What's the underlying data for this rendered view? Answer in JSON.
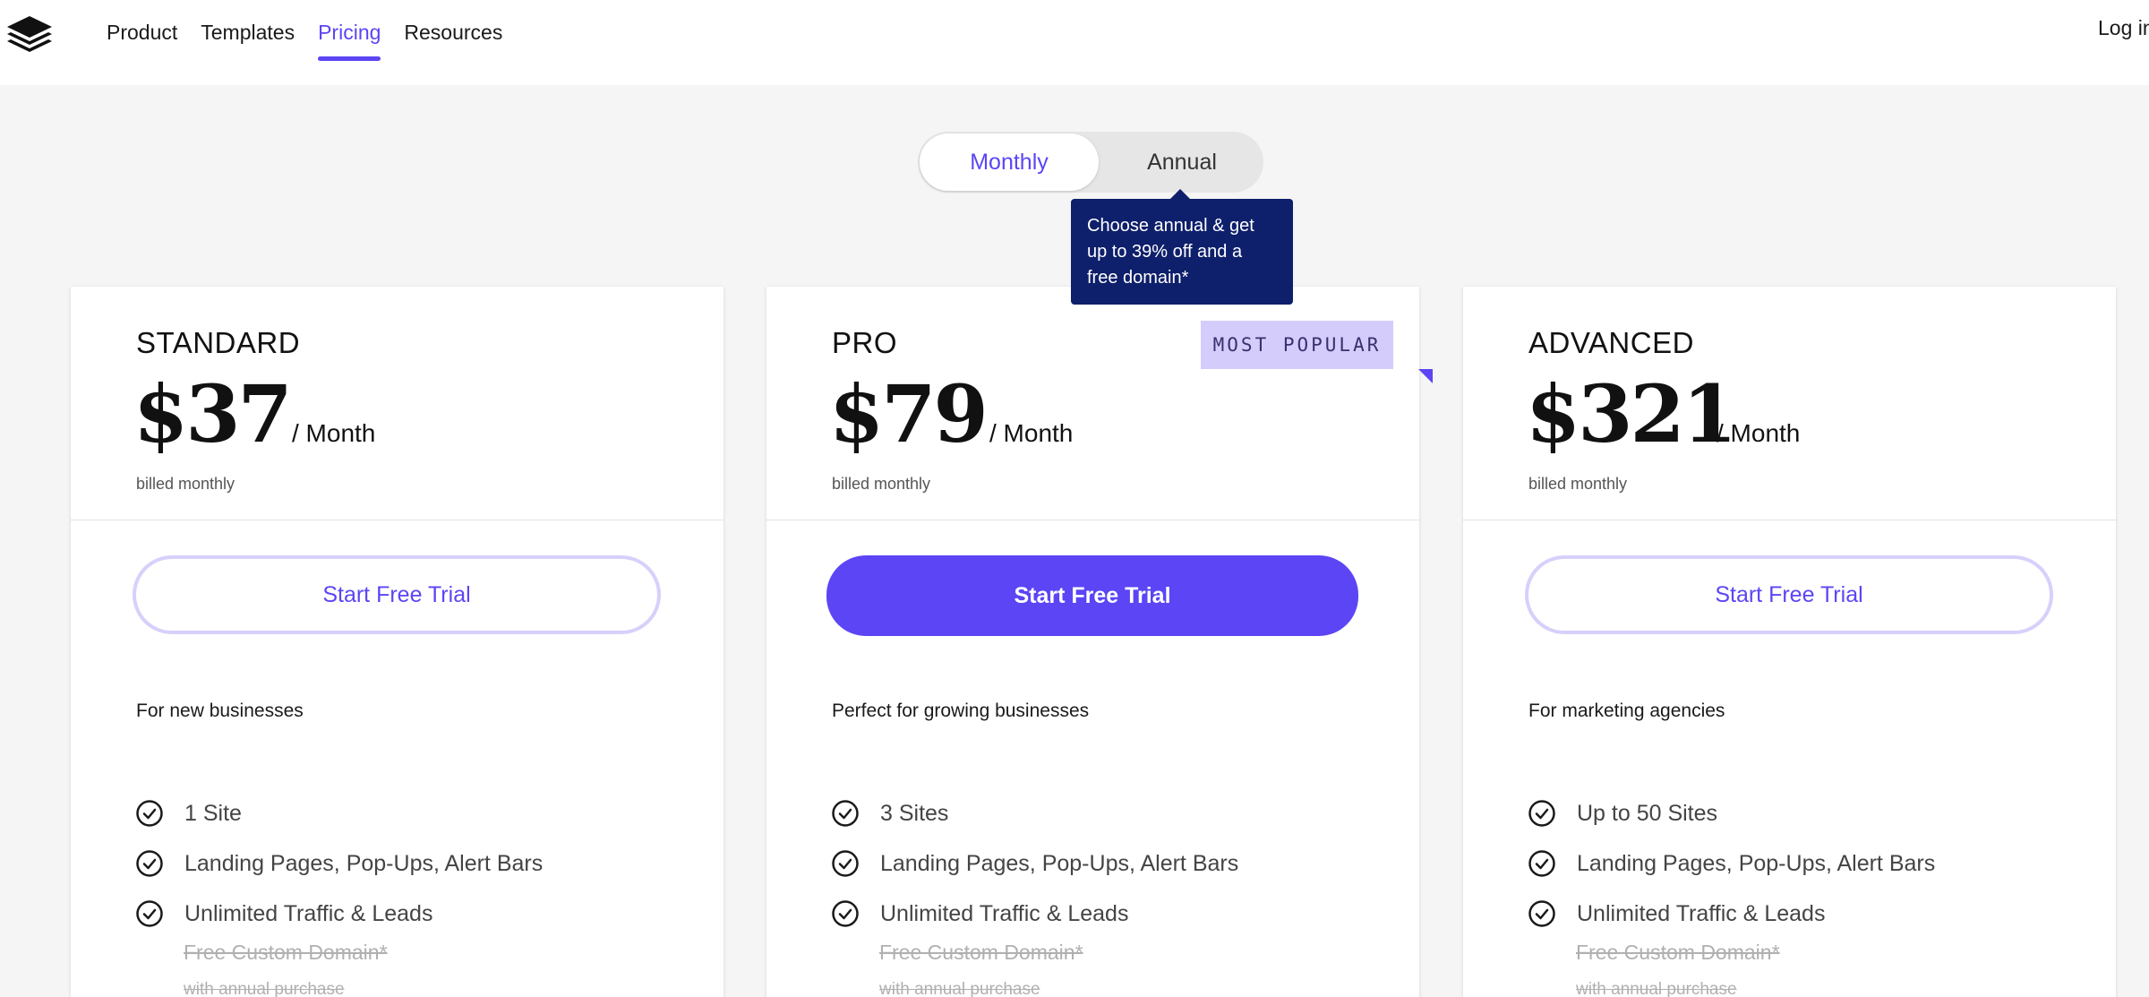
{
  "nav": {
    "items": [
      {
        "label": "Product",
        "active": false
      },
      {
        "label": "Templates",
        "active": false
      },
      {
        "label": "Pricing",
        "active": true
      },
      {
        "label": "Resources",
        "active": false
      }
    ],
    "login_label": "Log in"
  },
  "billing_toggle": {
    "monthly_label": "Monthly",
    "annual_label": "Annual",
    "selected": "Monthly",
    "tooltip": "Choose annual & get up to 39% off and a free domain*"
  },
  "plans": [
    {
      "name": "STANDARD",
      "price": "$37",
      "period": "/ Month",
      "billed": "billed monthly",
      "cta": "Start Free Trial",
      "tagline": "For new businesses",
      "features": [
        "1 Site",
        "Landing Pages, Pop-Ups, Alert Bars",
        "Unlimited Traffic & Leads"
      ],
      "struck_feature": "Free Custom Domain*",
      "struck_note": "with annual purchase"
    },
    {
      "name": "PRO",
      "badge": "MOST POPULAR",
      "price": "$79",
      "period": "/ Month",
      "billed": "billed monthly",
      "cta": "Start Free Trial",
      "tagline": "Perfect for growing businesses",
      "features": [
        "3 Sites",
        "Landing Pages, Pop-Ups, Alert Bars",
        "Unlimited Traffic & Leads"
      ],
      "struck_feature": "Free Custom Domain*",
      "struck_note": "with annual purchase"
    },
    {
      "name": "ADVANCED",
      "price": "$321",
      "period": "/ Month",
      "billed": "billed monthly",
      "cta": "Start Free Trial",
      "tagline": "For marketing agencies",
      "features": [
        "Up to 50 Sites",
        "Landing Pages, Pop-Ups, Alert Bars",
        "Unlimited Traffic & Leads"
      ],
      "struck_feature": "Free Custom Domain*",
      "struck_note": "with annual purchase"
    }
  ],
  "colors": {
    "accent": "#5b45f5",
    "accent_light": "#d4cdfb",
    "tooltip_bg": "#0e1f6b",
    "page_bg": "#f5f5f5"
  },
  "icons": {
    "logo": "layers-stack-icon",
    "feature": "check-circle-icon"
  }
}
